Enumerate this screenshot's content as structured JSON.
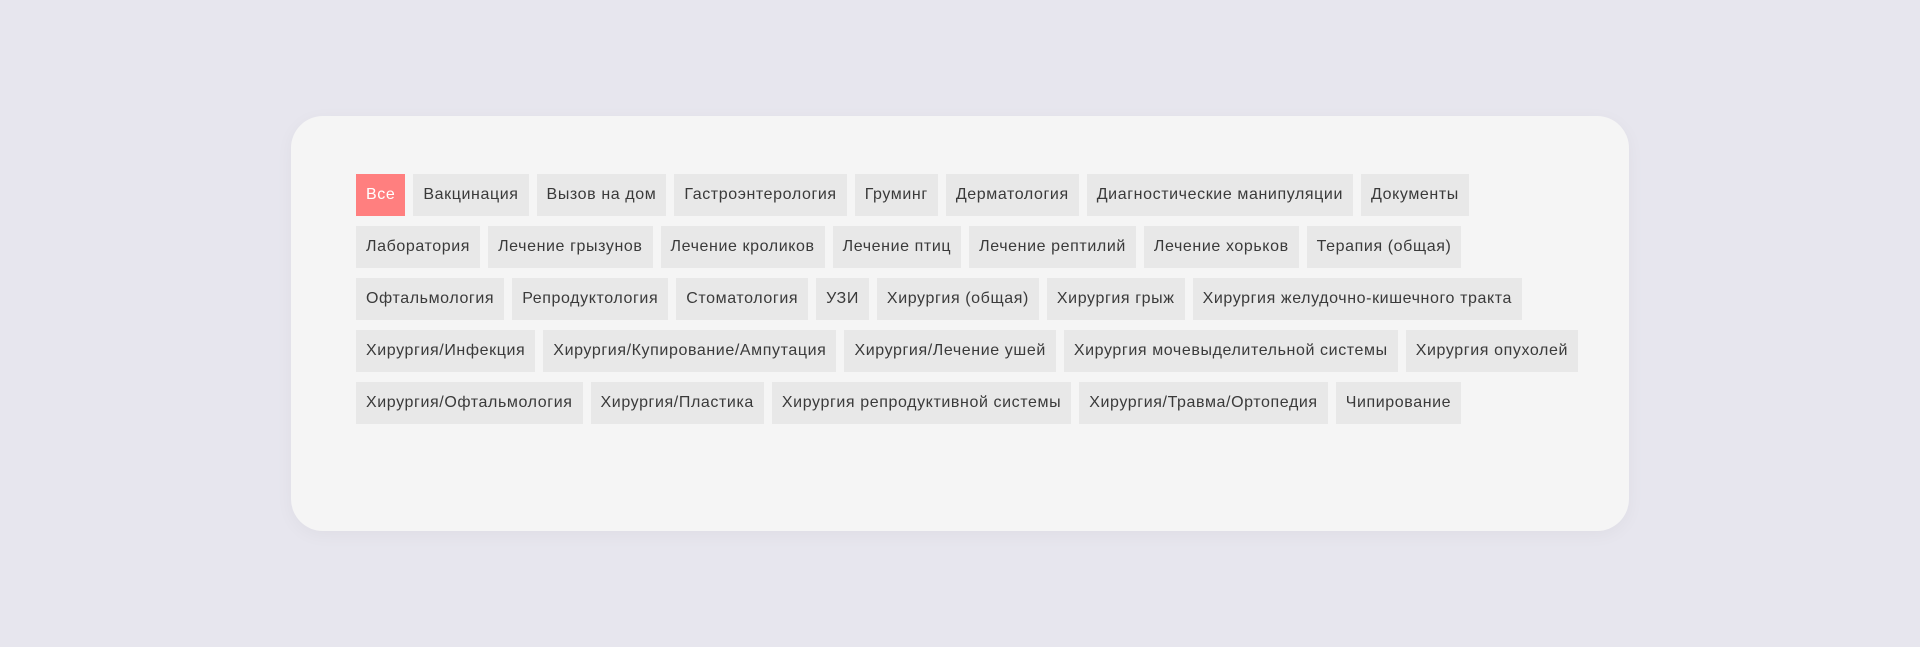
{
  "filters": {
    "active_index": 0,
    "active_color": "#ff7f7f",
    "tags": [
      "Все",
      "Вакцинация",
      "Вызов на дом",
      "Гастроэнтерология",
      "Груминг",
      "Дерматология",
      "Диагностические манипуляции",
      "Документы",
      "Лаборатория",
      "Лечение грызунов",
      "Лечение кроликов",
      "Лечение птиц",
      "Лечение рептилий",
      "Лечение хорьков",
      "Терапия (общая)",
      "Офтальмология",
      "Репродуктология",
      "Стоматология",
      "УЗИ",
      "Хирургия (общая)",
      "Хирургия грыж",
      "Хирургия желудочно-кишечного тракта",
      "Хирургия/Инфекция",
      "Хирургия/Купирование/Ампутация",
      "Хирургия/Лечение ушей",
      "Хирургия мочевыделительной системы",
      "Хирургия опухолей",
      "Хирургия/Офтальмология",
      "Хирургия/Пластика",
      "Хирургия репродуктивной системы",
      "Хирургия/Травма/Ортопедия",
      "Чипирование"
    ]
  }
}
